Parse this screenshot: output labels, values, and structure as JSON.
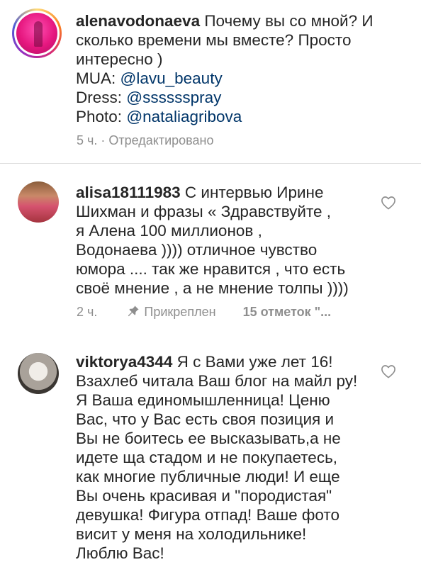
{
  "comments": [
    {
      "username": "alenavodonaeva",
      "text_lines": [
        " Почему вы со мной? И",
        "сколько времени мы вместе? Просто",
        "интересно )"
      ],
      "credits": [
        {
          "label": "MUA: ",
          "mention": "@lavu_beauty"
        },
        {
          "label": "Dress: ",
          "mention": "@sssssspray"
        },
        {
          "label": "Photo: ",
          "mention": "@nataliagribova"
        }
      ],
      "meta": "5 ч. · Отредактировано",
      "avatar_icon": "story-ring-avatar"
    },
    {
      "username": "alisa18111983",
      "text_lines": [
        " С интервью Ирине",
        "Шихман и фразы « Здравствуйте ,",
        "я Алена 100 миллионов ,",
        "Водонаева )))) отличное чувство",
        "юмора .... так же нравится , что есть",
        "своё мнение , а не мнение толпы ))))"
      ],
      "time": "2 ч.",
      "pinned_label": "Прикреплен",
      "likes": "15 отметок \"...",
      "like_icon": "heart-outline-icon"
    },
    {
      "username": "viktorya4344",
      "text_lines": [
        " Я с Вами уже лет 16!",
        "Взахлеб читала Ваш блог на майл ру!",
        "Я Ваша единомышленница! Ценю",
        "Вас, что у Вас есть своя позиция и",
        "Вы не боитесь ее высказывать,а не",
        "идете ща стадом и не покупаетесь,",
        "как многие публичные люди! И еще",
        "Вы очень красивая и \"породистая\"",
        "девушка! Фигура отпад! Ваше фото",
        "висит у меня на холодильнике!",
        "Люблю Вас!"
      ],
      "like_icon": "heart-outline-icon"
    }
  ],
  "colors": {
    "text": "#262626",
    "mention": "#003569",
    "meta": "#8e8e8e",
    "divider": "#dbdbdb"
  }
}
